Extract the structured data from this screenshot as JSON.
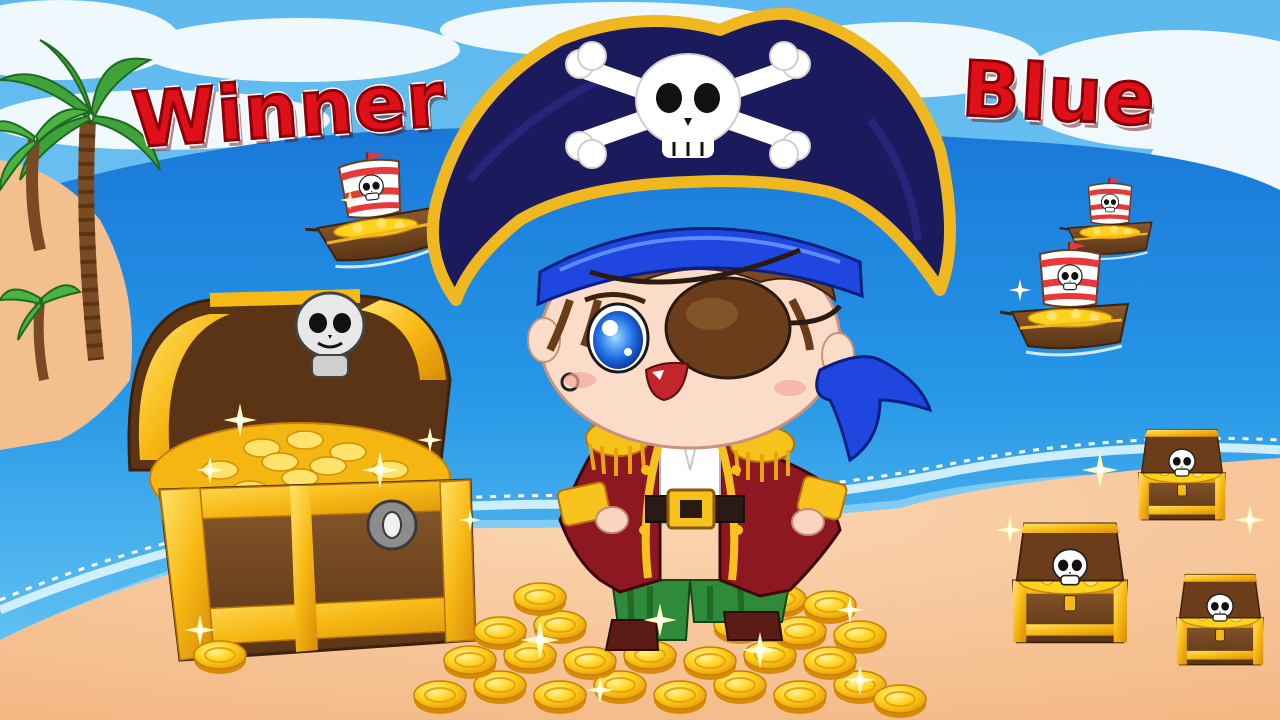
{
  "title": {
    "left_word": "Winner",
    "right_word": "Blue"
  },
  "scene": {
    "character": "pirate-boy",
    "items": [
      "treasure-chest",
      "pirate-ship",
      "pirate-ship",
      "pirate-ship",
      "treasure-chest",
      "treasure-chest",
      "treasure-chest",
      "gold-coins",
      "palm-tree"
    ]
  },
  "colors": {
    "sky": "#6ec3f0",
    "sea": "#1e8fe0",
    "sand": "#f7c9a0",
    "title_red": "#e0101a",
    "gold": "#f8c81a",
    "hat_navy": "#1b1a5c",
    "bandana_blue": "#1f47e0",
    "coat_red": "#8e1822"
  }
}
